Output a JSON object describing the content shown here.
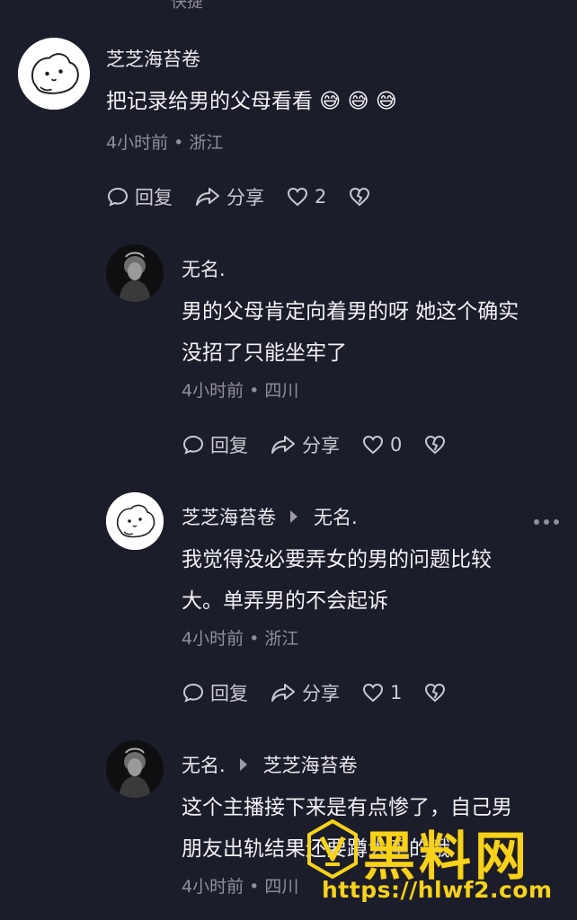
{
  "top_cut_text": "快捷",
  "actions_labels": {
    "reply": "回复",
    "share": "分享"
  },
  "comments": [
    {
      "user": "芝芝海苔卷",
      "reply_to": "",
      "text_lines": [
        "把记录给男的父母看看 😅 😅 😅"
      ],
      "meta": "4小时前 • 浙江",
      "likes": "2"
    },
    {
      "user": "无名.",
      "reply_to": "",
      "text_lines": [
        "男的父母肯定向着男的呀 她这个确实",
        "没招了只能坐牢了"
      ],
      "meta": "4小时前 • 四川",
      "likes": "0"
    },
    {
      "user": "芝芝海苔卷",
      "reply_to": "无名.",
      "text_lines": [
        "我觉得没必要弄女的男的问题比较",
        "大。单弄男的不会起诉"
      ],
      "meta": "4小时前 • 浙江",
      "likes": "1"
    },
    {
      "user": "无名.",
      "reply_to": "芝芝海苔卷",
      "text_lines": [
        "这个主播接下来是有点惨了，自己男",
        "朋友出轨结果还要蹲大牢的哦"
      ],
      "meta": "4小时前 • 四川",
      "likes": ""
    }
  ],
  "watermark": {
    "title": "黑料网",
    "url": "https://hlwf2.com"
  },
  "colors": {
    "background": "#1c1d2a",
    "watermark": "#f7d21a",
    "meta": "#8f909b"
  }
}
